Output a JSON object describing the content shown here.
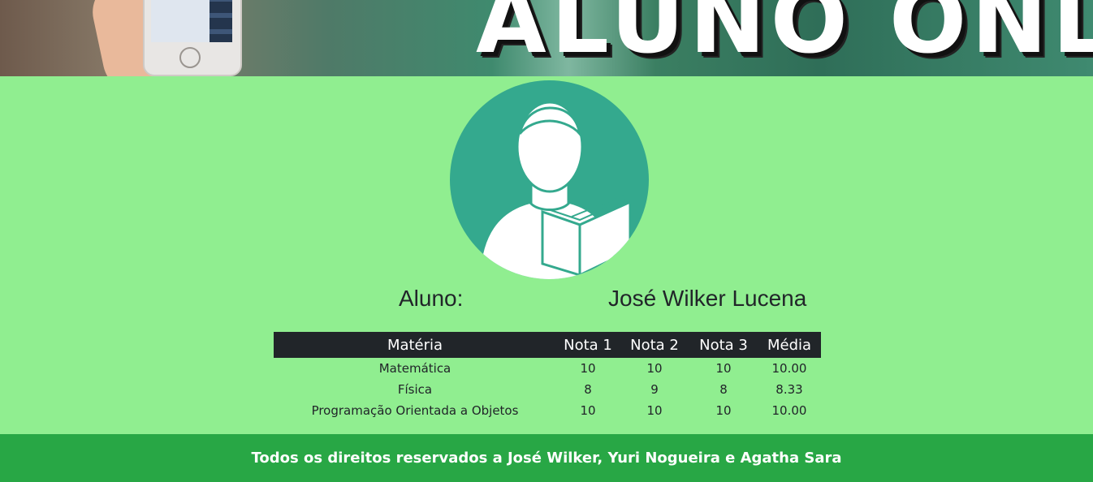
{
  "banner": {
    "title": "ALUNO ONLINE"
  },
  "student": {
    "label": "Aluno:",
    "name": "José Wilker Lucena"
  },
  "table": {
    "headers": [
      "Matéria",
      "Nota 1",
      "Nota 2",
      "Nota 3",
      "Média"
    ],
    "rows": [
      [
        "Matemática",
        "10",
        "10",
        "10",
        "10.00"
      ],
      [
        "Física",
        "8",
        "9",
        "8",
        "8.33"
      ],
      [
        "Programação Orientada a Objetos",
        "10",
        "10",
        "10",
        "10.00"
      ]
    ]
  },
  "footer": {
    "text": "Todos os direitos reservados a José Wilker, Yuri Nogueira e Agatha Sara"
  },
  "colors": {
    "page_bg": "#90ee90",
    "avatar_bg": "#34a98e",
    "table_header_bg": "#212529",
    "footer_bg": "#28a745"
  },
  "icons": {
    "avatar": "student-reading-book-icon"
  }
}
